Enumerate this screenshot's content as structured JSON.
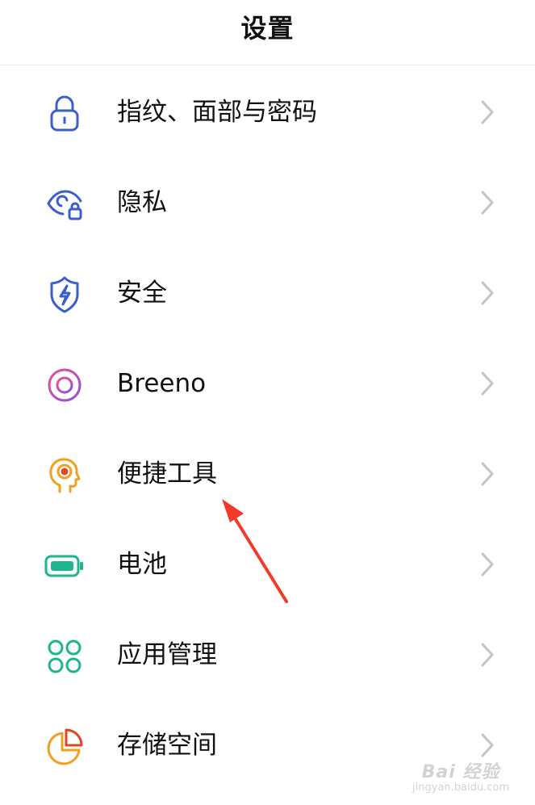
{
  "header": {
    "title": "设置"
  },
  "items": [
    {
      "label": "指纹、面部与密码",
      "icon": "lock-icon",
      "color": "#3a5fcd"
    },
    {
      "label": "隐私",
      "icon": "privacy-eye-lock-icon",
      "color": "#3a5fcd"
    },
    {
      "label": "安全",
      "icon": "shield-bolt-icon",
      "color": "#3a5fcd"
    },
    {
      "label": "Breeno",
      "icon": "breeno-ring-icon",
      "color": "#d6408f"
    },
    {
      "label": "便捷工具",
      "icon": "head-target-icon",
      "color": "#f0a020"
    },
    {
      "label": "电池",
      "icon": "battery-icon",
      "color": "#1fb58f"
    },
    {
      "label": "应用管理",
      "icon": "app-grid-icon",
      "color": "#1fb58f"
    },
    {
      "label": "存储空间",
      "icon": "pie-storage-icon",
      "color": "#f0a020"
    }
  ],
  "annotation": {
    "arrow_color": "#f23a2a"
  },
  "watermark": {
    "brand": "Bai 经验",
    "url": "jingyan.baidu.com"
  }
}
